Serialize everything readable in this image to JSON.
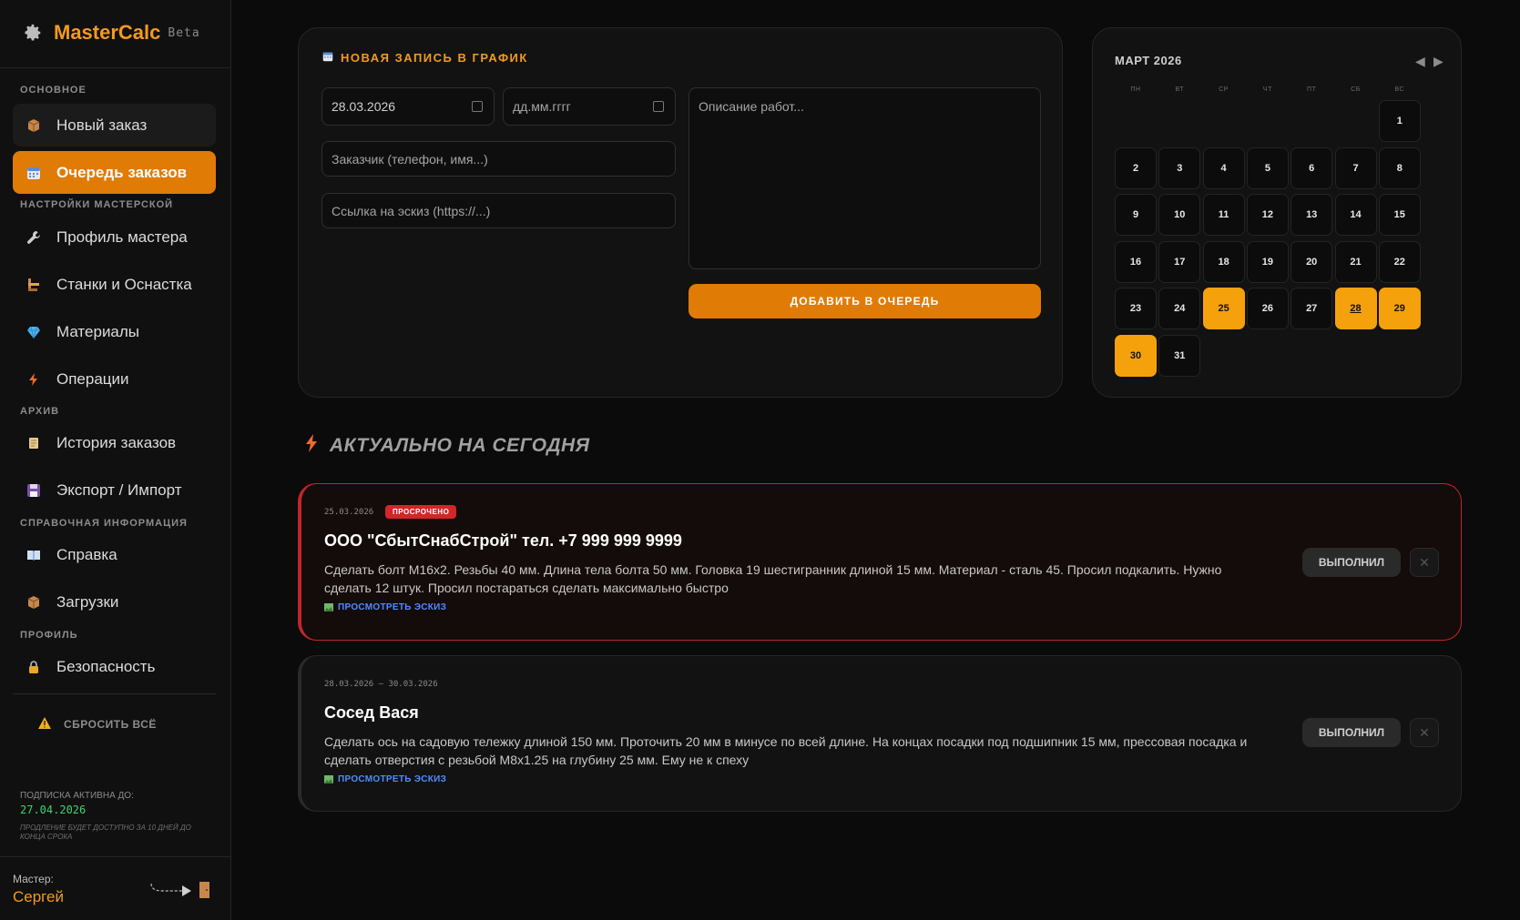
{
  "sidebar": {
    "brand": "MasterCalc",
    "beta": "Beta",
    "sections": {
      "main": "ОСНОВНОЕ",
      "workshop": "НАСТРОЙКИ МАСТЕРСКОЙ",
      "archive": "АРХИВ",
      "reference": "СПРАВОЧНАЯ ИНФОРМАЦИЯ",
      "profile": "ПРОФИЛЬ"
    },
    "items": {
      "new_order": "Новый заказ",
      "queue": "Очередь заказов",
      "master_profile": "Профиль мастера",
      "machines": "Станки и Оснастка",
      "materials": "Материалы",
      "operations": "Операции",
      "history": "История заказов",
      "export": "Экспорт / Импорт",
      "help": "Справка",
      "downloads": "Загрузки",
      "security": "Безопасность"
    },
    "reset": "СБРОСИТЬ ВСЁ",
    "subscription_label": "ПОДПИСКА АКТИВНА ДО:",
    "subscription_date": "27.04.2026",
    "subscription_note": "ПРОДЛЕНИЕ БУДЕТ ДОСТУПНО ЗА 10 ДНЕЙ ДО КОНЦА СРОКА",
    "master_label": "Мастер:",
    "master_name": "Сергей"
  },
  "form": {
    "title": "НОВАЯ ЗАПИСЬ В ГРАФИК",
    "start_date": "28.03.2026",
    "end_date_placeholder": "дд.мм.гггг",
    "customer_placeholder": "Заказчик (телефон, имя...)",
    "sketch_placeholder": "Ссылка на эскиз (https://...)",
    "description_placeholder": "Описание работ...",
    "add_button": "ДОБАВИТЬ В ОЧЕРЕДЬ"
  },
  "calendar": {
    "title": "МАРТ 2026",
    "prev": "◀",
    "next": "▶",
    "weekdays": [
      "ПН",
      "ВТ",
      "СР",
      "ЧТ",
      "ПТ",
      "СБ",
      "ВС"
    ],
    "first_weekday_index": 6,
    "days_in_month": 31,
    "highlighted_days": [
      25,
      28,
      29,
      30
    ],
    "today": 28
  },
  "today_heading": "АКТУАЛЬНО НА СЕГОДНЯ",
  "tasks": [
    {
      "date": "25.03.2026",
      "badge": "ПРОСРОЧЕНО",
      "title": "ООО \"СбытСнабСтрой\" тел. +7 999 999 9999",
      "description": "Сделать болт М16х2. Резьбы 40 мм. Длина тела болта 50 мм. Головка 19 шестигранник длиной 15 мм. Материал - сталь 45. Просил подкалить. Нужно сделать 12 штук. Просил постараться сделать максимально быстро",
      "link": "ПРОСМОТРЕТЬ ЭСКИЗ",
      "done": "ВЫПОЛНИЛ",
      "close": "✕"
    },
    {
      "date": "28.03.2026 — 30.03.2026",
      "title": "Сосед Вася",
      "description": "Сделать ось на садовую тележку длиной 150 мм. Проточить 20 мм в минусе по всей длине. На концах посадки под подшипник 15 мм, прессовая посадка и сделать отверстия с резьбой М8х1.25 на глубину 25 мм. Ему не к спеху",
      "link": "ПРОСМОТРЕТЬ ЭСКИЗ",
      "done": "ВЫПОЛНИЛ",
      "close": "✕"
    }
  ],
  "colors": {
    "accent": "#e07b06",
    "calendar_highlight": "#f5a10c",
    "overdue": "#c0262a",
    "link": "#4e8cff",
    "subscription": "#3fd26a"
  }
}
